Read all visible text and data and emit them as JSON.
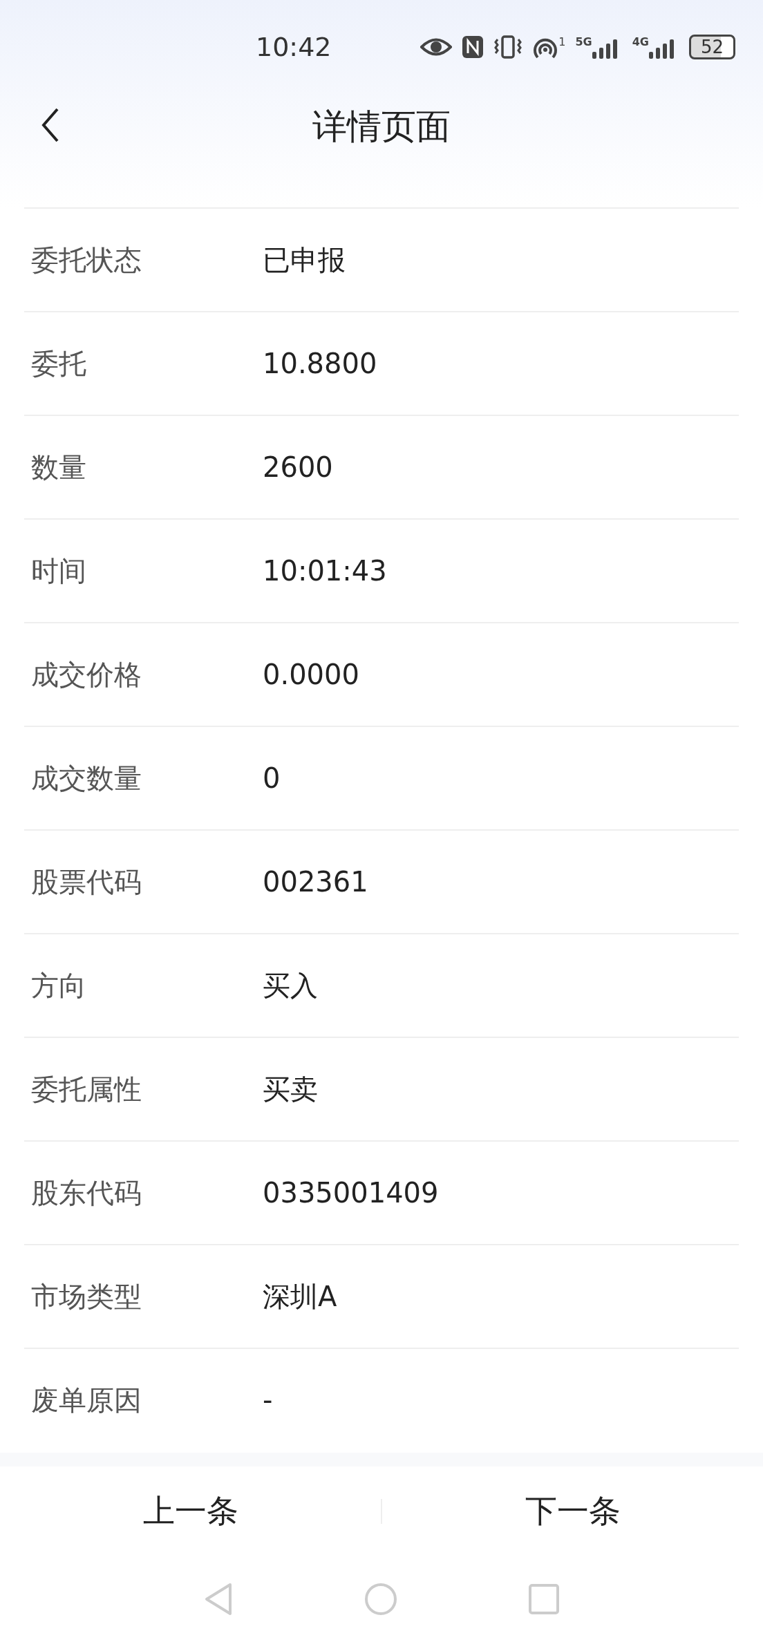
{
  "status_bar": {
    "time": "10:42",
    "hotspot_count": "1",
    "network_1": "5G",
    "network_2": "4G",
    "battery": "52"
  },
  "header": {
    "title": "详情页面"
  },
  "rows": [
    {
      "label": "委托状态",
      "value": "已申报"
    },
    {
      "label": "委托",
      "value": "10.8800"
    },
    {
      "label": "数量",
      "value": "2600"
    },
    {
      "label": "时间",
      "value": "10:01:43"
    },
    {
      "label": "成交价格",
      "value": "0.0000"
    },
    {
      "label": "成交数量",
      "value": "0"
    },
    {
      "label": "股票代码",
      "value": "002361"
    },
    {
      "label": "方向",
      "value": "买入"
    },
    {
      "label": "委托属性",
      "value": "买卖"
    },
    {
      "label": "股东代码",
      "value": "0335001409"
    },
    {
      "label": "市场类型",
      "value": "深圳A"
    },
    {
      "label": "废单原因",
      "value": "-"
    }
  ],
  "footer": {
    "prev": "上一条",
    "next": "下一条"
  }
}
